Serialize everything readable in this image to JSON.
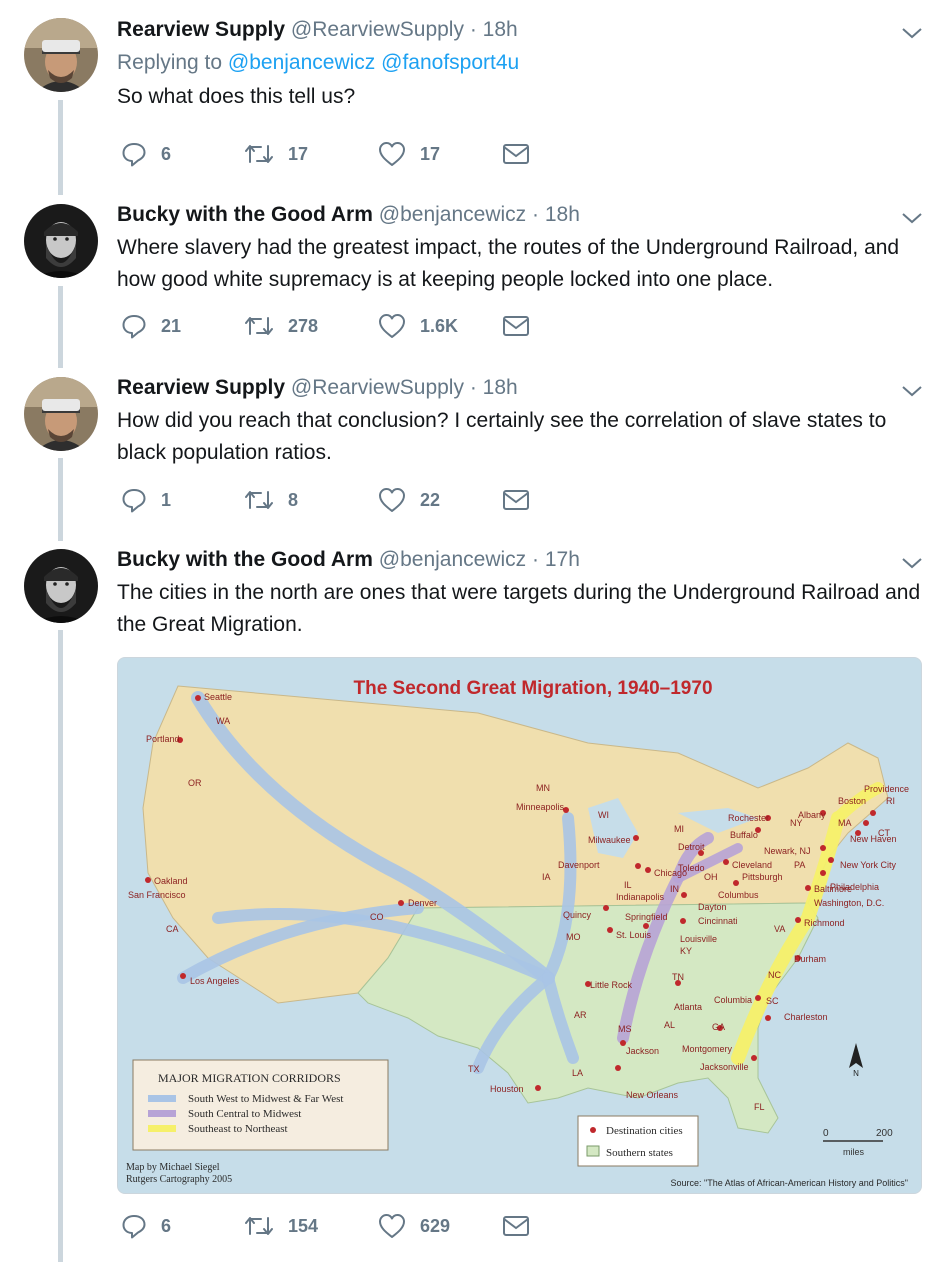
{
  "tweets": [
    {
      "name": "Rearview Supply",
      "handle": "@RearviewSupply",
      "time": "18h",
      "replying_prefix": "Replying to",
      "mentions": [
        "@benjancewicz",
        "@fanofsport4u"
      ],
      "text": "So what does this tell us?",
      "replies": "6",
      "retweets": "17",
      "likes": "17"
    },
    {
      "name": "Bucky with the Good Arm",
      "handle": "@benjancewicz",
      "time": "18h",
      "text": "Where slavery had the greatest impact, the routes of the Underground Railroad, and how good white supremacy is at keeping people locked into one place.",
      "replies": "21",
      "retweets": "278",
      "likes": "1.6K"
    },
    {
      "name": "Rearview Supply",
      "handle": "@RearviewSupply",
      "time": "18h",
      "text": "How did you reach that conclusion? I certainly see the correlation of slave states to black population ratios.",
      "replies": "1",
      "retweets": "8",
      "likes": "22"
    },
    {
      "name": "Bucky with the Good Arm",
      "handle": "@benjancewicz",
      "time": "17h",
      "text": "The cities in the north are ones that were targets during the Underground Railroad and the Great Migration.",
      "replies": "6",
      "retweets": "154",
      "likes": "629"
    }
  ],
  "separator": "·",
  "map": {
    "title": "The Second Great Migration, 1940–1970",
    "legend_title": "MAJOR MIGRATION CORRIDORS",
    "legend_items": [
      {
        "label": "South West to Midwest & Far West",
        "color": "#a9c4e6"
      },
      {
        "label": "South Central to Midwest",
        "color": "#b7a3d6"
      },
      {
        "label": "Southeast to Northeast",
        "color": "#f6f06a"
      }
    ],
    "destination_label": "Destination cities",
    "southern_label": "Southern states",
    "scale_start": "0",
    "scale_end": "200",
    "scale_unit": "miles",
    "credit_line1": "Map by Michael Siegel",
    "credit_line2": "Rutgers Cartography 2005",
    "source": "Source: \"The Atlas of African-American History and Politics\"",
    "north": "N",
    "colors": {
      "land": "#f0dfae",
      "south": "#d4e8c3",
      "water": "#c6dde9",
      "city": "#c0282c",
      "title": "#c0282c"
    },
    "cities": [
      "Seattle",
      "Portland",
      "Oakland",
      "San Francisco",
      "Los Angeles",
      "Denver",
      "Minneapolis",
      "Milwaukee",
      "Davenport",
      "Chicago",
      "Detroit",
      "Toledo",
      "Cleveland",
      "Pittsburgh",
      "Columbus",
      "Indianapolis",
      "Dayton",
      "Cincinnati",
      "Springfield",
      "Quincy",
      "St. Louis",
      "Louisville",
      "Little Rock",
      "Atlanta",
      "Columbia",
      "Charleston",
      "Montgomery",
      "Jacksonville",
      "Jackson",
      "New Orleans",
      "Houston",
      "Durham",
      "Richmond",
      "Baltimore",
      "Washington, D.C.",
      "Philadelphia",
      "New York City",
      "Newark, NJ",
      "New Haven",
      "Boston",
      "Providence",
      "Albany",
      "Rochester",
      "Buffalo"
    ],
    "states": [
      "WA",
      "OR",
      "CA",
      "CO",
      "TX",
      "MN",
      "WI",
      "IA",
      "MO",
      "AR",
      "LA",
      "MS",
      "AL",
      "GA",
      "FL",
      "SC",
      "NC",
      "VA",
      "KY",
      "TN",
      "IL",
      "IN",
      "OH",
      "MI",
      "PA",
      "NY",
      "MA",
      "RI",
      "CT"
    ]
  }
}
